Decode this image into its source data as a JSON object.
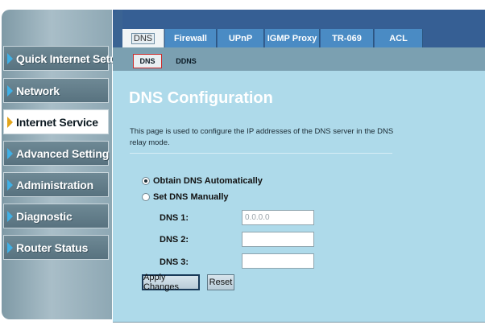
{
  "sidebar": {
    "items": [
      {
        "label": "Quick Internet Setup",
        "active": false
      },
      {
        "label": "Network",
        "active": false
      },
      {
        "label": "Internet Service",
        "active": true
      },
      {
        "label": "Advanced Setting",
        "active": false
      },
      {
        "label": "Administration",
        "active": false
      },
      {
        "label": "Diagnostic",
        "active": false
      },
      {
        "label": "Router Status",
        "active": false
      }
    ]
  },
  "tabs": [
    {
      "label": "DNS",
      "active": true
    },
    {
      "label": "Firewall",
      "active": false
    },
    {
      "label": "UPnP",
      "active": false
    },
    {
      "label": "IGMP Proxy",
      "active": false
    },
    {
      "label": "TR-069",
      "active": false
    },
    {
      "label": "ACL",
      "active": false
    }
  ],
  "subtabs": [
    {
      "label": "DNS",
      "active": true
    },
    {
      "label": "DDNS",
      "active": false
    }
  ],
  "main": {
    "title": "DNS Configuration",
    "description": "This page is used to configure the IP addresses of the DNS server in the DNS relay mode.",
    "radio_auto": {
      "label": "Obtain DNS Automatically",
      "checked": true
    },
    "radio_manual": {
      "label": "Set DNS Manually",
      "checked": false
    },
    "dns1": {
      "label": "DNS 1:",
      "value": "0.0.0.0",
      "disabled": true
    },
    "dns2": {
      "label": "DNS 2:",
      "value": ""
    },
    "dns3": {
      "label": "DNS 3:",
      "value": ""
    },
    "apply_label": "Apply Changes",
    "reset_label": "Reset"
  },
  "colors": {
    "tab_band": "#365f94",
    "tab": "#4a8bc4",
    "subtab_strip": "#7ba0b1",
    "content_bg": "#aedaea",
    "sidebar_item": "#58727f",
    "active_marker": "#cc2a2a"
  },
  "icons": {
    "nav_arrow": "triangle-right-icon",
    "active_nav_arrow": "triangle-right-icon"
  }
}
